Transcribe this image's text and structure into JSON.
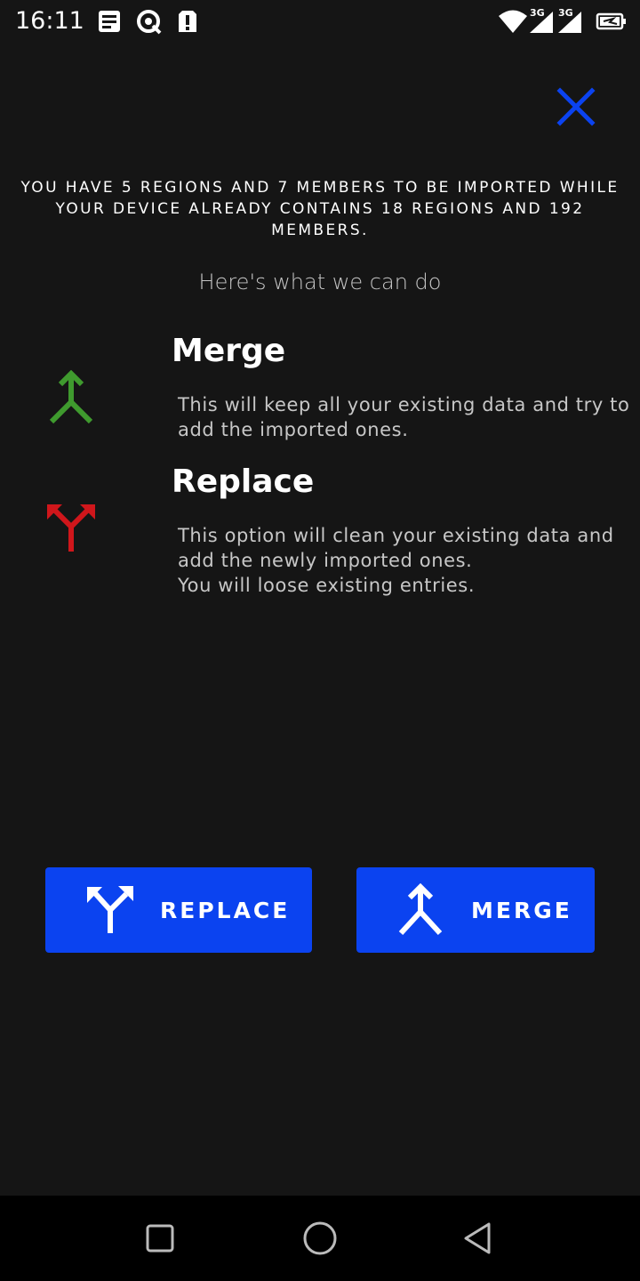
{
  "status_bar": {
    "time": "16:11",
    "icons": [
      "news-icon",
      "data-saver-icon",
      "alert-icon",
      "wifi-icon",
      "signal-3g-icon",
      "signal-3g-icon",
      "battery-icon"
    ],
    "network_label_1": "3G",
    "network_label_2": "3G"
  },
  "dialog": {
    "close_icon": "close-icon",
    "summary": "YOU HAVE 5 REGIONS AND 7 MEMBERS TO BE IMPORTED WHILE YOUR DEVICE ALREADY CONTAINS 18 REGIONS AND 192 MEMBERS.",
    "subtitle": "Here's what we can do",
    "options": [
      {
        "title": "Merge",
        "description": "This will keep all your existing data and try to add the imported ones.",
        "icon": "merge-icon",
        "icon_color": "#3f9a2e"
      },
      {
        "title": "Replace",
        "description": "This option will clean your existing data and add the newly imported ones.\nYou will loose existing entries.",
        "icon": "split-icon",
        "icon_color": "#d0161b"
      }
    ],
    "buttons": {
      "replace_label": "REPLACE",
      "merge_label": "MERGE"
    }
  },
  "nav_bar": {
    "items": [
      "recents-square-icon",
      "home-circle-icon",
      "back-triangle-icon"
    ]
  },
  "colors": {
    "accent": "#0b43f0",
    "background": "#151515",
    "merge_green": "#3f9a2e",
    "replace_red": "#d0161b"
  }
}
